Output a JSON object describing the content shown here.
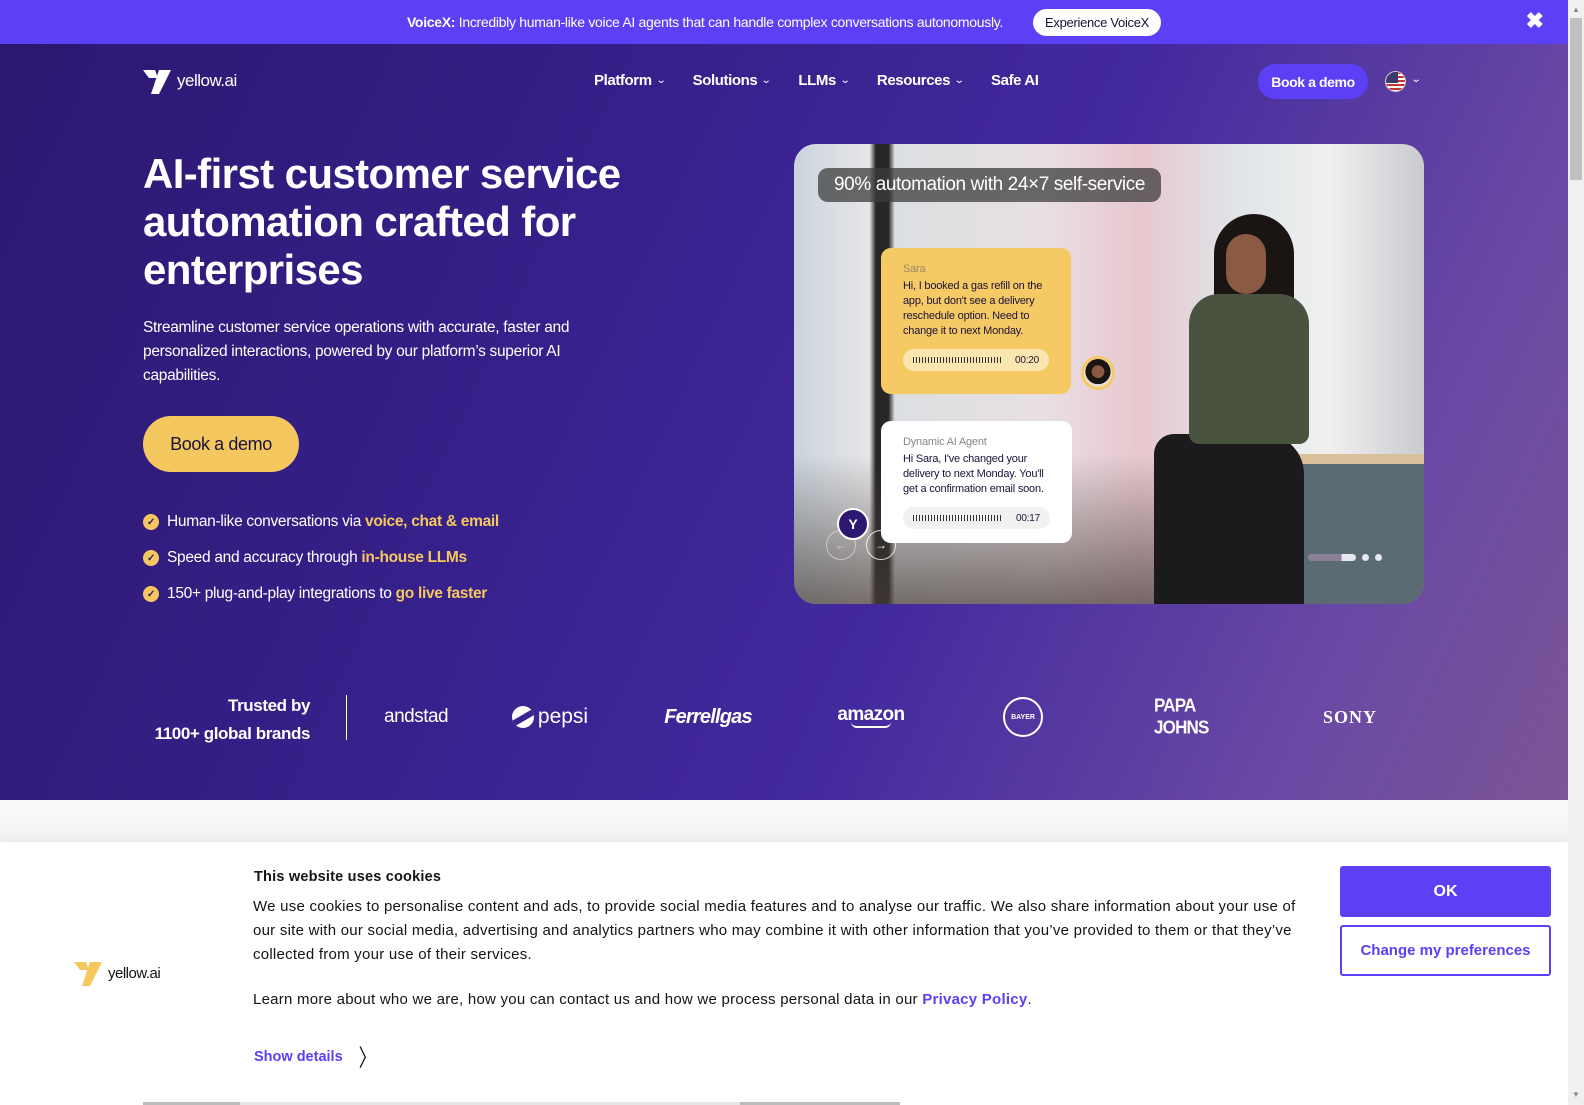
{
  "announcement": {
    "brand": "VoiceX:",
    "text": "Incredibly human-like voice AI agents that can handle complex conversations autonomously.",
    "cta": "Experience VoiceX",
    "close_icon": "close-icon"
  },
  "nav": {
    "logo_text": "yellow.ai",
    "items": [
      {
        "label": "Platform",
        "has_dropdown": true
      },
      {
        "label": "Solutions",
        "has_dropdown": true
      },
      {
        "label": "LLMs",
        "has_dropdown": true
      },
      {
        "label": "Resources",
        "has_dropdown": true
      },
      {
        "label": "Safe AI",
        "has_dropdown": false
      }
    ],
    "chevron": "⌄",
    "cta": "Book a demo",
    "language_icon": "us-flag-icon"
  },
  "hero": {
    "headline": "AI-first customer service automation crafted for enterprises",
    "subhead": "Streamline customer service operations with accurate, faster and personalized interactions, powered by our platform’s superior AI capabilities.",
    "cta": "Book a demo",
    "bullets": [
      {
        "text": "Human-like conversations via",
        "highlight": "voice, chat & email"
      },
      {
        "text": "Speed and accuracy through",
        "highlight": "in-house LLMs"
      },
      {
        "text": "150+ plug-and-play integrations to",
        "highlight": "go live faster"
      }
    ],
    "check_glyph": "✓"
  },
  "media": {
    "tagline": "90% automation with 24×7 self-service",
    "user_message": {
      "name": "Sara",
      "text": "Hi, I booked a gas refill on the app, but don't see a delivery reschedule option. Need to change it to next Monday.",
      "duration": "00:20"
    },
    "agent_message": {
      "name": "Dynamic AI Agent",
      "text": "Hi Sara, I've changed your delivery to next Monday. You'll get a confirmation email soon.",
      "duration": "00:17"
    },
    "bot_glyph": "Y",
    "prev_glyph": "←",
    "next_glyph": "→",
    "slides_total": 3,
    "active_slide": 1,
    "active_slide_progress": 0.7
  },
  "trusted": {
    "line1": "Trusted by",
    "line2": "1100+ global brands",
    "brands": [
      "andstad",
      "pepsi",
      "Ferrellgas",
      "amazon",
      "BAYER",
      "PAPA JOHNS",
      "SONY"
    ]
  },
  "cookie": {
    "logo_text": "yellow.ai",
    "title": "This website uses cookies",
    "body": "We use cookies to personalise content and ads, to provide social media features and to analyse our traffic. We also share information about your use of our site with our social media, advertising and analytics partners who may combine it with other information that you’ve provided to them or that they’ve collected from your use of their services.",
    "learn_more": "Learn more about who we are, how you can contact us and how we process personal data in our",
    "privacy_link": "Privacy Policy",
    "period": ".",
    "show_details": "Show details",
    "show_chev": "〉",
    "ok": "OK",
    "preferences": "Change my preferences"
  },
  "colors": {
    "brand_purple": "#5b40f5",
    "brand_yellow": "#f5c85f",
    "hero_dark": "#2c1870"
  }
}
